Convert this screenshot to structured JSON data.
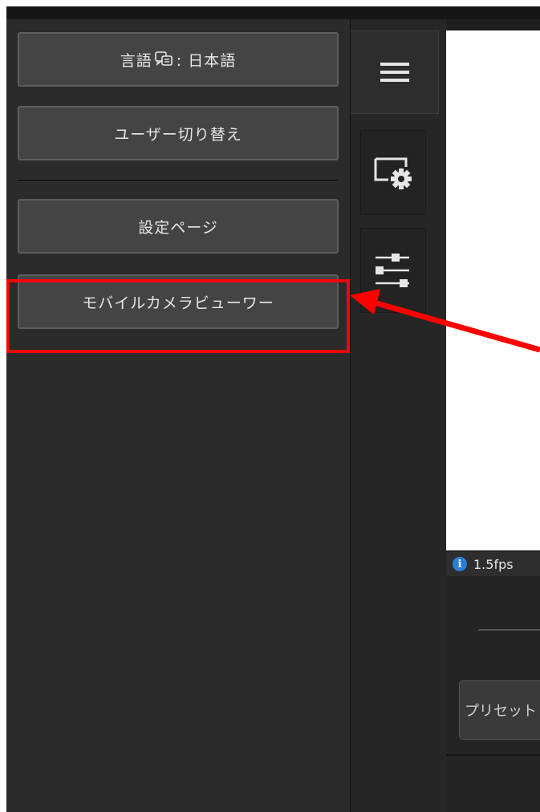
{
  "menu": {
    "language_prefix": "言語",
    "language_value": ": 日本語",
    "switch_user_label": "ユーザー切り替え",
    "settings_page_label": "設定ページ",
    "mobile_camera_viewer_label": "モバイルカメラビューワー"
  },
  "status": {
    "fps": "1.5fps"
  },
  "controls": {
    "preset_label": "プリセット"
  },
  "colors": {
    "highlight": "#ff0000",
    "arrow": "#ff0000",
    "info_icon": "#2c7fd6"
  }
}
